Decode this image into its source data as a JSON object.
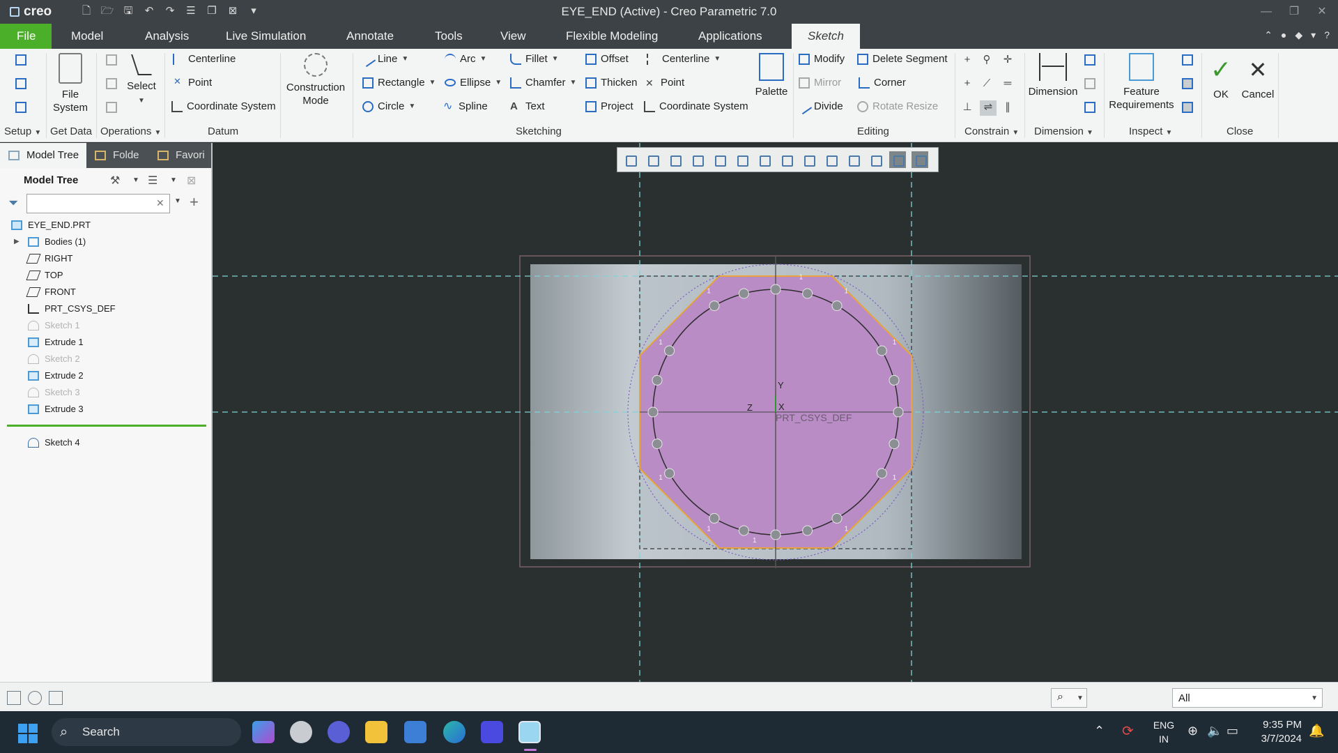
{
  "window": {
    "app_logo": "creo",
    "title": "EYE_END (Active) - Creo Parametric 7.0"
  },
  "tabs": [
    "File",
    "Model",
    "Analysis",
    "Live Simulation",
    "Annotate",
    "Tools",
    "View",
    "Flexible Modeling",
    "Applications",
    "Sketch"
  ],
  "active_tab": "Sketch",
  "ribbon": {
    "groups": {
      "setup": "Setup",
      "get_data": "Get Data",
      "operations": "Operations",
      "datum": "Datum",
      "sketching": "Sketching",
      "editing": "Editing",
      "constrain": "Constrain",
      "dimension": "Dimension",
      "inspect": "Inspect",
      "close": "Close"
    },
    "get_data": {
      "file_system": "File\nSystem"
    },
    "operations": {
      "select": "Select"
    },
    "datum": {
      "centerline": "Centerline",
      "point": "Point",
      "coordinate_system": "Coordinate System"
    },
    "construction_mode": "Construction\nMode",
    "sketching": {
      "line": "Line",
      "rectangle": "Rectangle",
      "circle": "Circle",
      "arc": "Arc",
      "ellipse": "Ellipse",
      "spline": "Spline",
      "fillet": "Fillet",
      "chamfer": "Chamfer",
      "text": "Text",
      "offset": "Offset",
      "thicken": "Thicken",
      "project": "Project",
      "centerline": "Centerline",
      "point": "Point",
      "coordinate_system": "Coordinate System",
      "palette": "Palette"
    },
    "editing": {
      "modify": "Modify",
      "mirror": "Mirror",
      "divide": "Divide",
      "delete_segment": "Delete Segment",
      "corner": "Corner",
      "rotate_resize": "Rotate Resize"
    },
    "dimension": {
      "dimension": "Dimension"
    },
    "inspect": {
      "feature_requirements": "Feature\nRequirements"
    },
    "close": {
      "ok": "OK",
      "cancel": "Cancel"
    }
  },
  "left_panel": {
    "tabs": [
      "Model Tree",
      "Folde",
      "Favori"
    ],
    "header": "Model Tree",
    "search_placeholder": "",
    "tree": [
      {
        "label": "EYE_END.PRT",
        "icon": "part-icon",
        "indent": 0,
        "dim": false
      },
      {
        "label": "Bodies (1)",
        "icon": "bodies-icon",
        "indent": 1,
        "dim": false,
        "expandable": true
      },
      {
        "label": "RIGHT",
        "icon": "datum-plane-icon",
        "indent": 1,
        "dim": false
      },
      {
        "label": "TOP",
        "icon": "datum-plane-icon",
        "indent": 1,
        "dim": false
      },
      {
        "label": "FRONT",
        "icon": "datum-plane-icon",
        "indent": 1,
        "dim": false
      },
      {
        "label": "PRT_CSYS_DEF",
        "icon": "csys-icon",
        "indent": 1,
        "dim": false
      },
      {
        "label": "Sketch 1",
        "icon": "sketch-icon",
        "indent": 1,
        "dim": true
      },
      {
        "label": "Extrude 1",
        "icon": "extrude-icon",
        "indent": 1,
        "dim": false
      },
      {
        "label": "Sketch 2",
        "icon": "sketch-icon",
        "indent": 1,
        "dim": true
      },
      {
        "label": "Extrude 2",
        "icon": "extrude-icon",
        "indent": 1,
        "dim": false
      },
      {
        "label": "Sketch 3",
        "icon": "sketch-icon",
        "indent": 1,
        "dim": true
      },
      {
        "label": "Extrude 3",
        "icon": "extrude-icon",
        "indent": 1,
        "dim": false
      }
    ],
    "active_item": {
      "label": "Sketch 4",
      "icon": "sketch-icon"
    }
  },
  "graphics": {
    "csys_label": "PRT_CSYS_DEF",
    "axis_y": "Y",
    "axis_x": "X",
    "axis_z": "Z",
    "constraint_mark": "1"
  },
  "status_bar": {
    "filter_value": "All"
  },
  "taskbar": {
    "search": "Search",
    "lang_line1": "ENG",
    "lang_line2": "IN",
    "time": "9:35 PM",
    "date": "3/7/2024"
  },
  "colors": {
    "file_tab": "#4caf2a",
    "sketch_fill": "#b98cc6",
    "sketch_outline": "#e8a33a",
    "reference_line": "#7fd3d8"
  }
}
